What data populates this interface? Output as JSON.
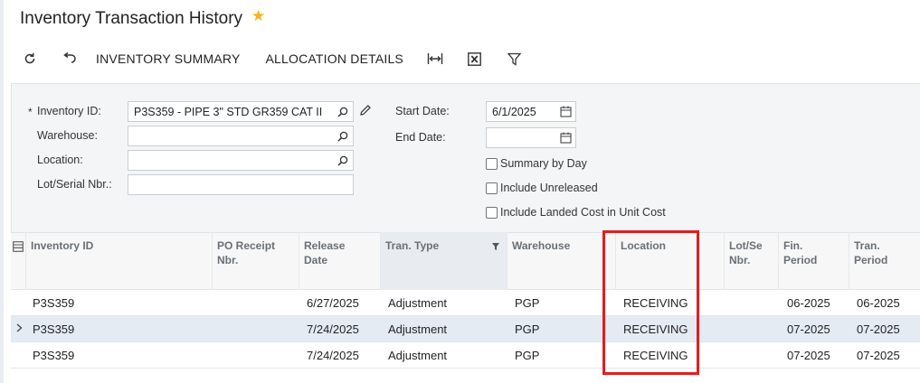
{
  "page": {
    "title": "Inventory Transaction History",
    "favorite_icon": "star-icon",
    "accent": "#f2b418"
  },
  "toolbar": {
    "refresh_icon": "refresh-icon",
    "undo_icon": "undo-icon",
    "inventory_summary": "INVENTORY SUMMARY",
    "allocation_details": "ALLOCATION DETAILS",
    "fit_icon": "fit-to-screen-icon",
    "excel_icon": "excel-export-icon",
    "filter_icon": "filter-icon"
  },
  "filters": {
    "inventory_id": {
      "label": "Inventory ID:",
      "required_mark": "*",
      "value": "P3S359 - PIPE 3\" STD GR359 CAT II"
    },
    "warehouse": {
      "label": "Warehouse:",
      "value": ""
    },
    "location": {
      "label": "Location:",
      "value": ""
    },
    "lot_serial": {
      "label": "Lot/Serial Nbr.:",
      "value": ""
    },
    "start_date": {
      "label": "Start Date:",
      "value": "6/1/2025"
    },
    "end_date": {
      "label": "End Date:",
      "value": ""
    },
    "summary_by_day": {
      "label": "Summary by Day",
      "checked": false
    },
    "include_unreleased": {
      "label": "Include Unreleased",
      "checked": false
    },
    "include_landed_cost": {
      "label": "Include Landed Cost in Unit Cost",
      "checked": false
    }
  },
  "grid": {
    "columns": {
      "inventory_id": "Inventory ID",
      "po_receipt_1": "PO Receipt",
      "po_receipt_2": "Nbr.",
      "release_date_1": "Release",
      "release_date_2": "Date",
      "tran_type": "Tran. Type",
      "warehouse": "Warehouse",
      "location": "Location",
      "lot_1": "Lot/Se",
      "lot_2": "Nbr.",
      "fin_period_1": "Fin.",
      "fin_period_2": "Period",
      "tran_period_1": "Tran.",
      "tran_period_2": "Period"
    },
    "rows": [
      {
        "inventory_id": "P3S359",
        "po_receipt": "",
        "release_date": "6/27/2025",
        "tran_type": "Adjustment",
        "warehouse": "PGP",
        "location": "RECEIVING",
        "lot": "",
        "fin_period": "06-2025",
        "tran_period": "06-2025"
      },
      {
        "inventory_id": "P3S359",
        "po_receipt": "",
        "release_date": "7/24/2025",
        "tran_type": "Adjustment",
        "warehouse": "PGP",
        "location": "RECEIVING",
        "lot": "",
        "fin_period": "07-2025",
        "tran_period": "07-2025"
      },
      {
        "inventory_id": "P3S359",
        "po_receipt": "",
        "release_date": "7/24/2025",
        "tran_type": "Adjustment",
        "warehouse": "PGP",
        "location": "RECEIVING",
        "lot": "",
        "fin_period": "07-2025",
        "tran_period": "07-2025"
      }
    ]
  },
  "annotation": {
    "color": "#e01e1e"
  }
}
